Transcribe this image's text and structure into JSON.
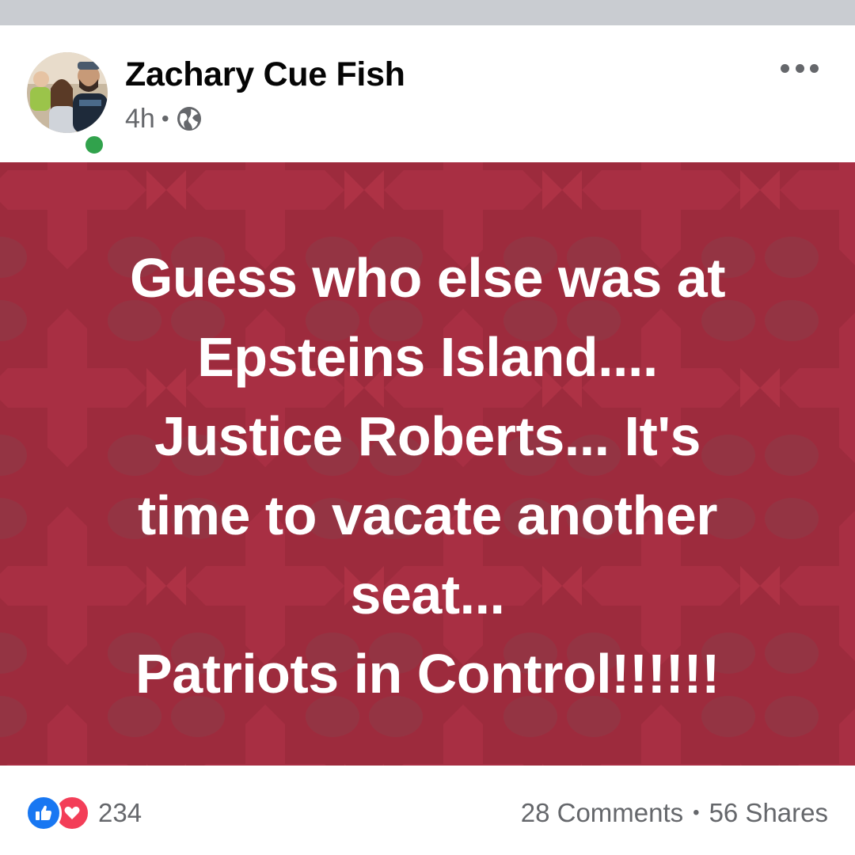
{
  "post": {
    "author_name": "Zachary Cue Fish",
    "timestamp": "4h",
    "meta_separator": "•",
    "privacy_icon": "globe-icon",
    "more_icon": "more-options-icon",
    "background_color": "#9d2b3d",
    "text_lines": [
      "Guess who else was at",
      "Epsteins Island....",
      "Justice Roberts... It's",
      "time to vacate another",
      "seat...",
      "Patriots in Control!!!!!!"
    ]
  },
  "footer": {
    "reaction_icons": [
      "like-icon",
      "love-icon"
    ],
    "reaction_count": "234",
    "comments": "28 Comments",
    "separator": "•",
    "shares": "56 Shares"
  },
  "colors": {
    "top_strip": "#c9ccd1",
    "online": "#31a24c",
    "like": "#1877f2",
    "love": "#f33e58",
    "meta_text": "#65676b"
  }
}
